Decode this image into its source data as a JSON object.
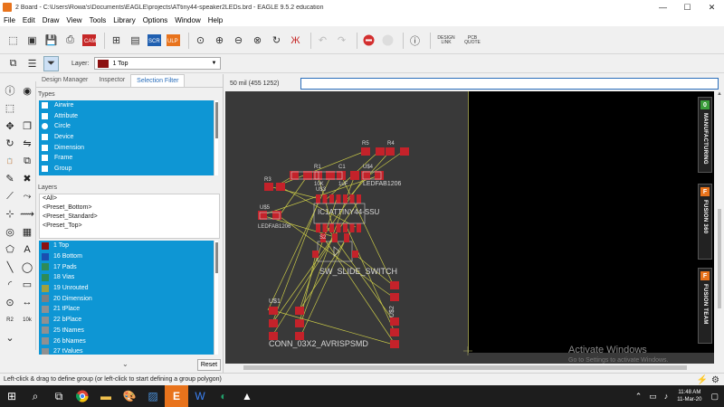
{
  "window": {
    "title": "2 Board - C:\\Users\\Rowa's\\Documents\\EAGLE\\projects\\ATtiny44-speaker2LEDs.brd - EAGLE 9.5.2 education",
    "minimize": "—",
    "maximize": "☐",
    "close": "✕"
  },
  "menu": [
    "File",
    "Edit",
    "Draw",
    "View",
    "Tools",
    "Library",
    "Options",
    "Window",
    "Help"
  ],
  "toolbar": {
    "design_link": "DESIGN LINK",
    "pcb_quote": "PCB QUOTE",
    "layer_label": "Layer:",
    "layer_value": "1 Top",
    "layer_color": "#8c1010"
  },
  "panel": {
    "tabs": [
      "Design Manager",
      "Inspector",
      "Selection Filter"
    ],
    "active_tab": 2,
    "types_label": "Types",
    "types": [
      {
        "label": "Airwire",
        "icon": "airwire-icon"
      },
      {
        "label": "Attribute",
        "icon": "attribute-icon"
      },
      {
        "label": "Circle",
        "icon": "circle-icon"
      },
      {
        "label": "Device",
        "icon": "device-icon"
      },
      {
        "label": "Dimension",
        "icon": "dimension-icon"
      },
      {
        "label": "Frame",
        "icon": "frame-icon"
      },
      {
        "label": "Group",
        "icon": "group-icon"
      }
    ],
    "layers_label": "Layers",
    "presets": [
      "<All>",
      "<Preset_Bottom>",
      "<Preset_Standard>",
      "<Preset_Top>"
    ],
    "layers": [
      {
        "label": "1 Top",
        "color": "#8c1010"
      },
      {
        "label": "16 Bottom",
        "color": "#1a4fb0"
      },
      {
        "label": "17 Pads",
        "color": "#2e8b57"
      },
      {
        "label": "18 Vias",
        "color": "#2e8b57"
      },
      {
        "label": "19 Unrouted",
        "color": "#a0a040"
      },
      {
        "label": "20 Dimension",
        "color": "#808080"
      },
      {
        "label": "21 tPlace",
        "color": "#909090"
      },
      {
        "label": "22 bPlace",
        "color": "#909090"
      },
      {
        "label": "25 tNames",
        "color": "#909090"
      },
      {
        "label": "26 bNames",
        "color": "#909090"
      },
      {
        "label": "27 tValues",
        "color": "#909090"
      }
    ],
    "reset": "Reset"
  },
  "command": {
    "coords": "50 mil (455 1252)",
    "value": ""
  },
  "board": {
    "labels": {
      "r5": "R5",
      "r4": "R4",
      "r1": "R1",
      "c1": "C1",
      "u4": "U$4",
      "r3": "R3",
      "r1_val": "10K",
      "c1_val": "1uF",
      "led1": "LEDFAB1206",
      "u3": "U$3",
      "ic1_val": "IC1ATTINY44-SSU",
      "u5": "U$5",
      "led2": "LEDFAB1206",
      "s2": "S2",
      "switch": "SW_SLIDE_SWITCH",
      "u1": "U$1",
      "u2": "U$2",
      "conn": "CONN_03X2_AVRISPSMD"
    }
  },
  "side_tabs": [
    {
      "label": "MANUFACTURING",
      "badge": "0",
      "badge_color": "#3a9d3a"
    },
    {
      "label": "FUSION 360",
      "badge": "F",
      "badge_color": "#e8731c"
    },
    {
      "label": "FUSION TEAM",
      "badge": "F",
      "badge_color": "#e8731c"
    }
  ],
  "watermark": {
    "title": "Activate Windows",
    "subtitle": "Go to Settings to activate Windows."
  },
  "status": "Left-click & drag to define group (or left-click to start defining a group polygon)",
  "taskbar": {
    "time": "11:48 AM",
    "date": "11-Mar-20"
  }
}
